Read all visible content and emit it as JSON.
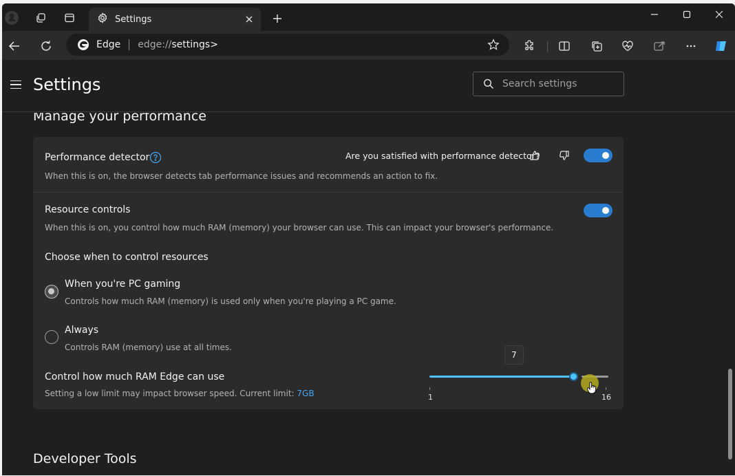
{
  "browser": {
    "tab": {
      "title": "Settings"
    },
    "address": {
      "brand": "Edge",
      "url_prefix": "edge://",
      "url_path": "settings>"
    }
  },
  "header": {
    "title": "Settings",
    "search_placeholder": "Search settings"
  },
  "sections": {
    "performance": {
      "title": "Manage your performance"
    },
    "developer": {
      "title": "Developer Tools"
    }
  },
  "performance_detector": {
    "title": "Performance detector",
    "feedback_question": "Are you satisfied with performance detector?",
    "description": "When this is on, the browser detects tab performance issues and recommends an action to fix.",
    "enabled": true
  },
  "resource_controls": {
    "title": "Resource controls",
    "description": "When this is on, you control how much RAM (memory) your browser can use. This can impact your browser's performance.",
    "enabled": true,
    "choose_label": "Choose when to control resources",
    "options": [
      {
        "label": "When you're PC gaming",
        "description": "Controls how much RAM (memory) is used only when you're playing a PC game.",
        "selected": true
      },
      {
        "label": "Always",
        "description": "Controls RAM (memory) use at all times.",
        "selected": false
      }
    ],
    "ram": {
      "title": "Control how much RAM Edge can use",
      "description_prefix": "Setting a low limit may impact browser speed. Current limit:",
      "current_limit": "7GB",
      "slider": {
        "value": 7,
        "value_label": "7",
        "min": 1,
        "max": 16,
        "min_label": "1",
        "max_label": "16"
      }
    }
  },
  "colors": {
    "accent": "#2a7cd1",
    "slider": "#4cc2ff",
    "link": "#4aa6f0"
  }
}
